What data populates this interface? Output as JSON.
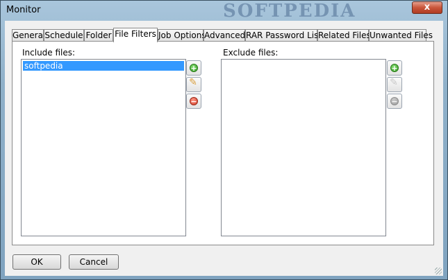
{
  "window": {
    "title": "Monitor",
    "watermark": "SOFTPEDIA",
    "close_glyph": "x"
  },
  "tabs": [
    {
      "label": "General"
    },
    {
      "label": "Schedule"
    },
    {
      "label": "Folder"
    },
    {
      "label": "File Filters",
      "active": true
    },
    {
      "label": "Job Options"
    },
    {
      "label": "Advanced"
    },
    {
      "label": "RAR Password List"
    },
    {
      "label": "Related Files"
    },
    {
      "label": "Unwanted Files"
    }
  ],
  "include": {
    "label": "Include files:",
    "items": [
      "softpedia"
    ],
    "selected": "softpedia"
  },
  "exclude": {
    "label": "Exclude files:",
    "items": []
  },
  "icons": {
    "add": "add-icon",
    "edit": "pencil-icon",
    "remove": "remove-icon"
  },
  "colors": {
    "selection": "#3399ff",
    "add": "#2f9a1e",
    "remove": "#d23a22"
  },
  "footer": {
    "ok_label": "OK",
    "cancel_label": "Cancel"
  }
}
